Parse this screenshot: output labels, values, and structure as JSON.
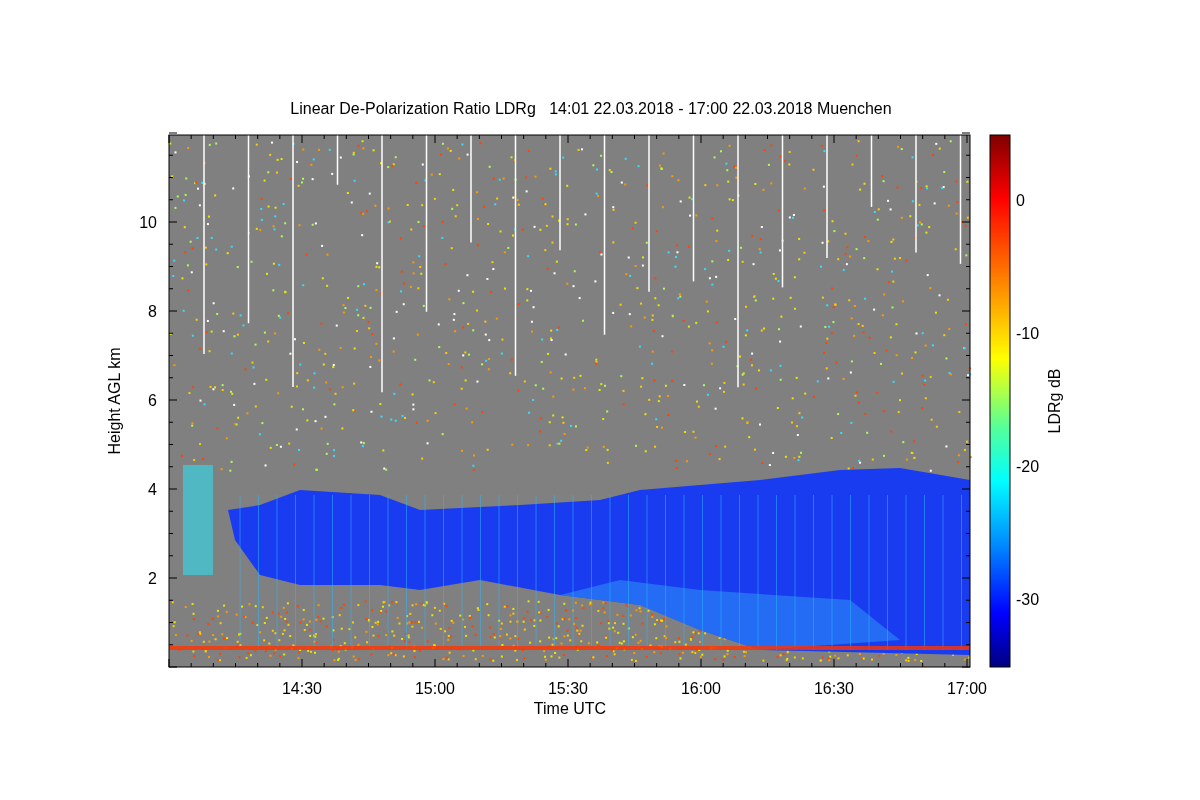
{
  "plot": {
    "title": "Linear De-Polarization Ratio LDRg   14:01 22.03.2018 - 17:00 22.03.2018 Muenchen",
    "xlabel": "Time UTC",
    "ylabel": "Height AGL km",
    "xticks": [
      "14:30",
      "15:00",
      "15:30",
      "16:00",
      "16:30",
      "17:00"
    ],
    "yticks": [
      "10",
      "8",
      "6",
      "4",
      "2"
    ]
  },
  "colorbar": {
    "label": "LDRg dB",
    "ticks": [
      "0",
      "-10",
      "-20",
      "-30"
    ]
  }
}
